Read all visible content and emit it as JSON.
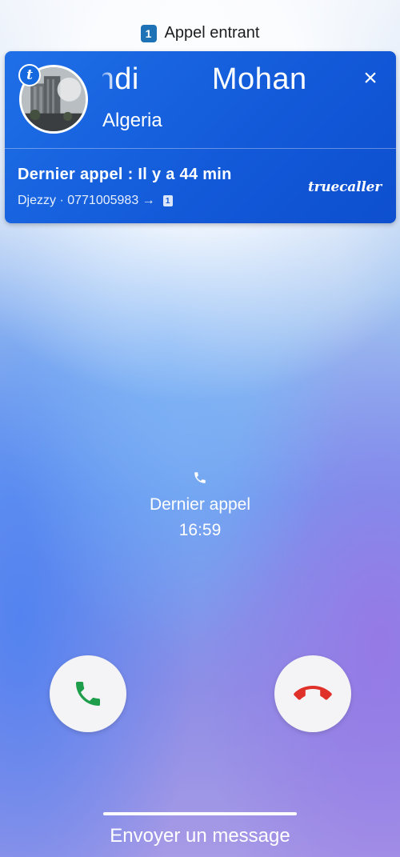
{
  "header": {
    "sim_number": "1",
    "title": "Appel entrant"
  },
  "caller_card": {
    "avatar_badge": "t",
    "name": "ehdi Mohan",
    "country": "Algeria",
    "last_call": "Dernier appel : Il y a 44 min",
    "carrier_info": "Djezzy · 0771005983 →",
    "carrier_sim": "1",
    "brand": "truecaller",
    "close_icon": "×"
  },
  "call_info": {
    "label": "Dernier appel",
    "time": "16:59"
  },
  "actions": {
    "accept_icon": "phone-icon",
    "decline_icon": "phone-hangup-icon",
    "accept_color": "#1e9e4a",
    "decline_color": "#e0302a"
  },
  "footer": {
    "send_message": "Envoyer un message"
  }
}
